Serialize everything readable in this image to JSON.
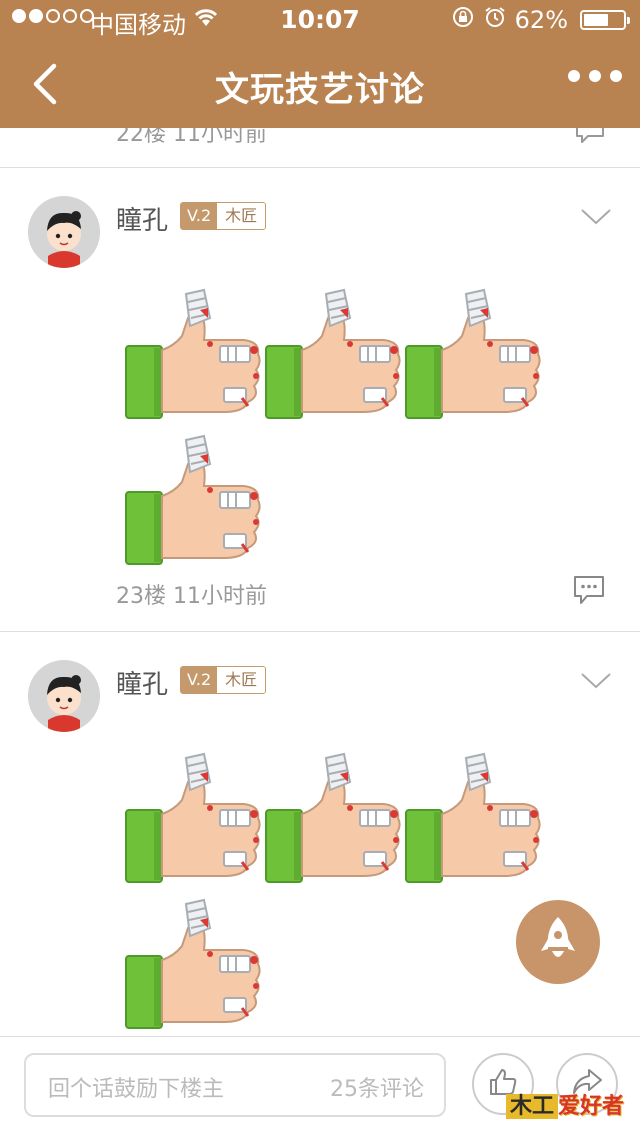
{
  "status_bar": {
    "carrier": "中国移动",
    "time": "10:07",
    "battery": "62%",
    "battery_level": 0.62
  },
  "nav": {
    "title": "文玩技艺讨论",
    "back_icon": "chevron-left-icon",
    "more_icon": "more-icon"
  },
  "previous_post": {
    "meta": "22楼 11小时前"
  },
  "posts": [
    {
      "username": "瞳孔",
      "level": "V.2",
      "rank": "木匠",
      "emoji_count": 4,
      "emoji": "bandaged-thumbs-up-icon",
      "meta": "23楼 11小时前"
    },
    {
      "username": "瞳孔",
      "level": "V.2",
      "rank": "木匠",
      "emoji_count": 4,
      "emoji": "bandaged-thumbs-up-icon"
    }
  ],
  "bottom_bar": {
    "placeholder": "回个话鼓励下楼主",
    "comment_count": "25条评论"
  },
  "watermark": {
    "part1": "木工",
    "part2": "爱好者"
  },
  "colors": {
    "brand": "#b98251",
    "badge": "#c49a6c",
    "sleeve_green": "#6fc13a"
  }
}
